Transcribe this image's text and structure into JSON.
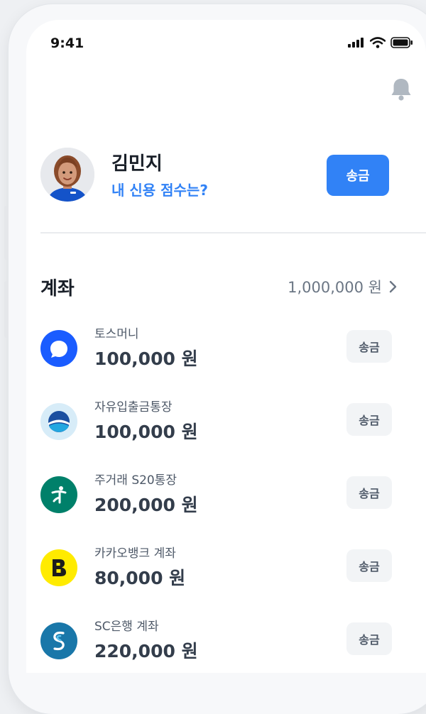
{
  "status_bar": {
    "time": "9:41"
  },
  "profile": {
    "name": "김민지",
    "credit_prompt": "내 신용 점수는?",
    "send_label": "송금"
  },
  "accounts": {
    "title": "계좌",
    "total": "1,000,000 원",
    "items": [
      {
        "name": "토스머니",
        "balance": "100,000 원",
        "send_label": "송금",
        "logo": "toss-logo"
      },
      {
        "name": "자유입출금통장",
        "balance": "100,000 원",
        "send_label": "송금",
        "logo": "blue-wave-bank-logo"
      },
      {
        "name": "주거래 S20통장",
        "balance": "200,000 원",
        "send_label": "송금",
        "logo": "hana-bank-logo"
      },
      {
        "name": "카카오뱅크 계좌",
        "balance": "80,000 원",
        "send_label": "송금",
        "logo": "kakaobank-logo"
      },
      {
        "name": "SC은행 계좌",
        "balance": "220,000 원",
        "send_label": "송금",
        "logo": "sc-bank-logo"
      }
    ]
  },
  "colors": {
    "accent": "#3182f6",
    "toss_blue": "#1a5cff",
    "hana_green": "#00806a",
    "kakao_yellow": "#ffeb00",
    "sc_blue": "#1977a9"
  }
}
